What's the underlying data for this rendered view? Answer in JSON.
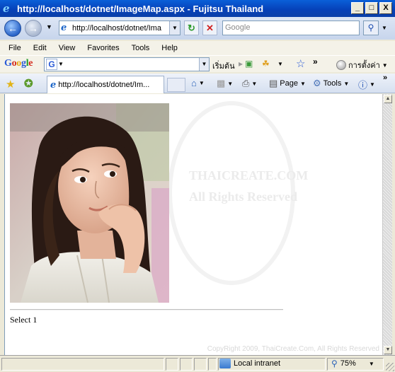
{
  "window": {
    "title": "http://localhost/dotnet/ImageMap.aspx - Fujitsu Thailand",
    "controls": [
      "_",
      "□",
      "X"
    ]
  },
  "address_bar": {
    "url": "http://localhost/dotnet/Ima",
    "search_placeholder": "Google"
  },
  "menu": [
    "File",
    "Edit",
    "View",
    "Favorites",
    "Tools",
    "Help"
  ],
  "google_toolbar": {
    "logo": "Google",
    "search_icon_letter": "G",
    "start_label": "เริ่มต้น",
    "settings_label": "การตั้งค่า"
  },
  "tab_bar": {
    "tab_title": "http://localhost/dotnet/Im...",
    "page_label": "Page",
    "tools_label": "Tools"
  },
  "content": {
    "select_label": "Select 1",
    "watermark_line1": "THAICREATE.COM",
    "watermark_line2": "All Rights Reserved",
    "copyright": "CopyRight 2009, ThaiCreate.Com, All Rights Reserved"
  },
  "status_bar": {
    "zone": "Local intranet",
    "zoom": "75%"
  }
}
